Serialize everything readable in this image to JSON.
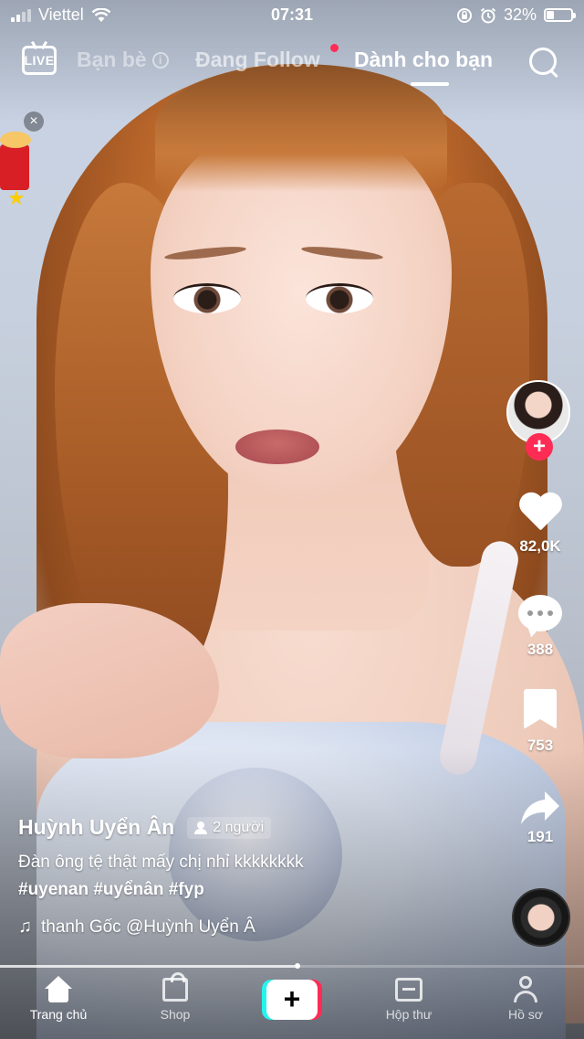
{
  "status_bar": {
    "carrier": "Viettel",
    "time": "07:31",
    "battery_percent": "32%",
    "battery_level": 0.32
  },
  "top_nav": {
    "live_label": "LIVE",
    "friends_label": "Bạn bè",
    "following_label": "Đang Follow",
    "for_you_label": "Dành cho bạn"
  },
  "actions": {
    "likes": "82,0K",
    "comments": "388",
    "saves": "753",
    "shares": "191"
  },
  "caption": {
    "username": "Huỳnh Uyển Ân",
    "viewers": "2 người",
    "description": "Đàn ông tệ thật mấy chị nhỉ kkkkkkkk",
    "hashtags": "#uyenan #uyểnân #fyp",
    "music": "thanh Gốc    @Huỳnh Uyển Â"
  },
  "progress": {
    "value": 0.51
  },
  "bottom_nav": {
    "home": "Trang chủ",
    "shop": "Shop",
    "create": "+",
    "inbox": "Hộp thư",
    "profile": "Hồ sơ"
  },
  "colors": {
    "accent_red": "#fe2c55",
    "accent_cyan": "#25f4ee"
  }
}
